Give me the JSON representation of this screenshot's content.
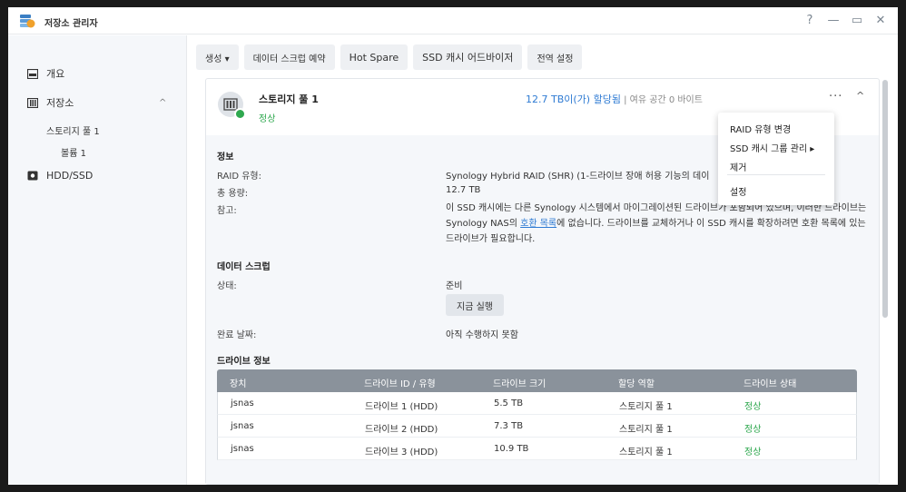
{
  "window": {
    "title": "저장소 관리자",
    "controls": [
      "?",
      "—",
      "▭",
      "✕"
    ]
  },
  "sidebar": {
    "overview": "개요",
    "storage": "저장소",
    "storage_pool": "스토리지 풀 1",
    "volume": "볼륨 1",
    "hdd": "HDD/SSD"
  },
  "toolbar": {
    "create": "생성 ▾",
    "scrub_schedule": "데이터 스크럽 예약",
    "hot_spare": "Hot Spare",
    "ssd_advisor": "SSD 캐시 어드바이저",
    "global_settings": "전역 설정"
  },
  "pool": {
    "name": "스토리지 풀 1",
    "status": "정상",
    "allocated": "12.7 TB이(가) 할당됨",
    "free": " | 여유 공간 0 바이트",
    "more": "···",
    "collapse": "^"
  },
  "info": {
    "title": "정보",
    "raid_label": "RAID 유형:",
    "raid_value": "Synology Hybrid RAID (SHR) (1-드라이브 장애 허용 기능의 데이",
    "capacity_label": "총 용량:",
    "capacity_value": "12.7 TB",
    "note_label": "참고:",
    "note_1": "이 SSD 캐시에는 다른 Synology 시스템에서 마이그레이션된 드라이브가 포함되어 있으며, 이러한 드라이브는 Synology NAS의 ",
    "note_link": "호환 목록",
    "note_2": "에 없습니다. 드라이브를 교체하거나 이 SSD 캐시를 확장하려면 호환 목록에 있는 드라이브가 필요합니다."
  },
  "scrub": {
    "title": "데이터 스크럽",
    "state_label": "상태:",
    "state_value": "준비",
    "run_now": "지금 실행",
    "done_label": "완료 날짜:",
    "done_value": "아직 수행하지 못함"
  },
  "drive_info": {
    "title": "드라이브 정보",
    "headers": [
      "장치",
      "드라이브 ID / 유형",
      "드라이브 크기",
      "할당 역할",
      "드라이브 상태"
    ],
    "rows": [
      [
        "jsnas",
        "드라이브 1 (HDD)",
        "5.5 TB",
        "스토리지 풀 1",
        "정상"
      ],
      [
        "jsnas",
        "드라이브 2 (HDD)",
        "7.3 TB",
        "스토리지 풀 1",
        "정상"
      ],
      [
        "jsnas",
        "드라이브 3 (HDD)",
        "10.9 TB",
        "스토리지 풀 1",
        "정상"
      ]
    ]
  },
  "context_menu": {
    "change_raid": "RAID 유형 변경",
    "ssd_cache_group": "SSD 캐시 그룹 관리 ▸",
    "remove": "제거",
    "settings": "설정"
  },
  "colors": {
    "ok": "#2fa84f",
    "link": "#2f7bd3",
    "table_header": "#8a929b"
  }
}
